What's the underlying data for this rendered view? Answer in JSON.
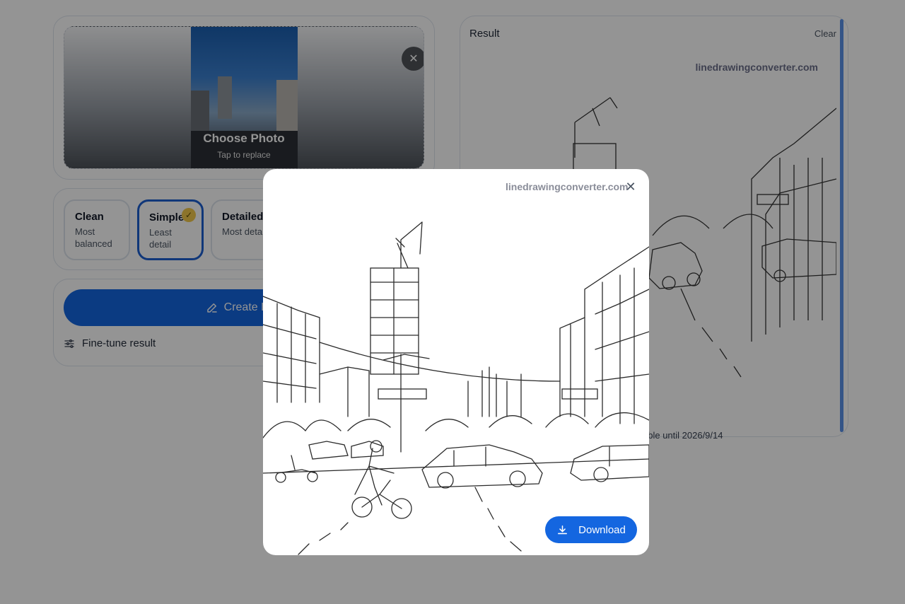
{
  "upload": {
    "title": "Choose Photo",
    "subtitle": "Tap to replace",
    "remove_icon": "close-icon"
  },
  "modes": [
    {
      "label": "Clean",
      "desc": "Most balanced",
      "selected": false
    },
    {
      "label": "Simple",
      "desc": "Least detail",
      "selected": true
    },
    {
      "label": "Detailed",
      "desc": "Most detail",
      "selected": false
    }
  ],
  "actions": {
    "create_label": "Create Line",
    "create_icon": "pencil-icon",
    "finetune_label": "Fine-tune result",
    "finetune_icon": "sliders-icon"
  },
  "result": {
    "title": "Result",
    "clear_label": "Clear",
    "watermark": "linedrawingconverter.com",
    "availability": "able until 2026/9/14"
  },
  "modal": {
    "watermark": "linedrawingconverter.com",
    "close_icon": "close-icon",
    "download_label": "Download",
    "download_icon": "download-icon"
  },
  "colors": {
    "accent": "#1466e0",
    "selected_border": "#1d5fd0",
    "check_badge": "#f2c84b",
    "overlay": "rgba(0,0,0,0.42)"
  }
}
